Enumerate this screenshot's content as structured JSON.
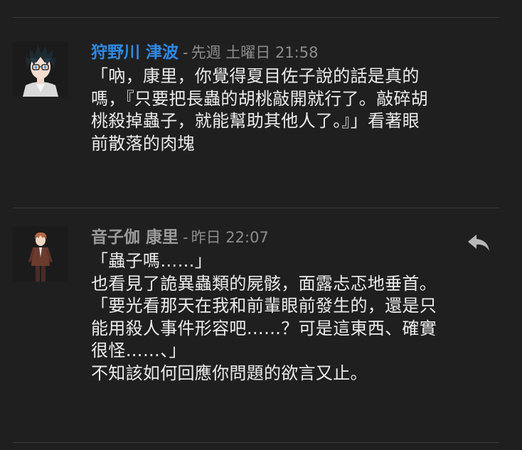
{
  "posts": [
    {
      "author": "狩野川 津波",
      "separator": "-",
      "timestamp": "先週 土曜日 21:58",
      "author_color": "#2e8ae6",
      "avatar": "anime-boy-glasses-avatar",
      "lines": [
        "「吶，康里，你覺得夏目佐子說的話是真的",
        "嗎，『只要把長蟲的胡桃敲開就行了。敲碎胡",
        "桃殺掉蟲子，就能幫助其他人了。』」看著眼",
        "前散落的肉塊"
      ]
    },
    {
      "author": "音子伽 康里",
      "separator": "-",
      "timestamp": "昨日 22:07",
      "author_color": "#9a9a9a",
      "avatar": "anime-boy-suit-avatar",
      "reply_icon": "reply-icon",
      "lines": [
        "「蟲子嗎……」",
        "也看見了詭異蟲類的屍骸，面露忐忑地垂首。",
        "「要光看那天在我和前輩眼前發生的，還是只",
        "能用殺人事件形容吧……？可是這東西、確實",
        "很怪……、」",
        "不知該如何回應你問題的欲言又止。"
      ]
    }
  ]
}
